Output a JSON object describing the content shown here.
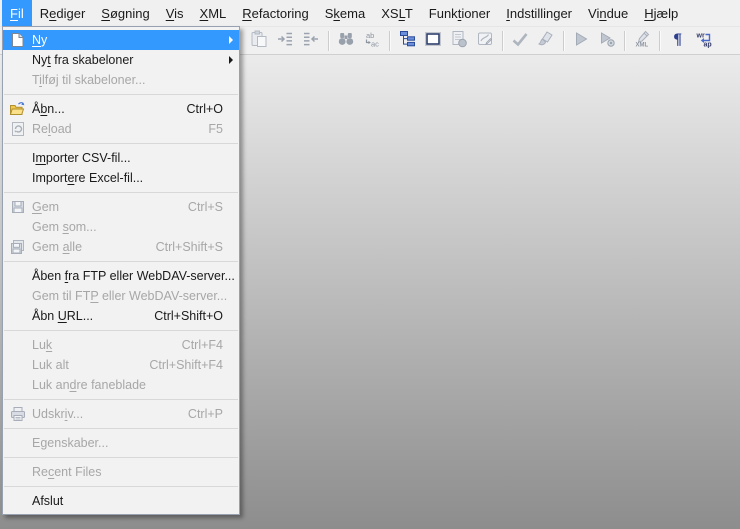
{
  "menubar": {
    "items": [
      {
        "id": "fil",
        "label": "Fil",
        "mnemonic": 0,
        "active": true
      },
      {
        "id": "rediger",
        "label": "Rediger",
        "mnemonic": 1
      },
      {
        "id": "sogning",
        "label": "Søgning",
        "mnemonic": 0
      },
      {
        "id": "vis",
        "label": "Vis",
        "mnemonic": 0
      },
      {
        "id": "xml",
        "label": "XML",
        "mnemonic": 0
      },
      {
        "id": "refactoring",
        "label": "Refactoring",
        "mnemonic": 0
      },
      {
        "id": "skema",
        "label": "Skema",
        "mnemonic": 1
      },
      {
        "id": "xslt",
        "label": "XSLT",
        "mnemonic": 2
      },
      {
        "id": "funktioner",
        "label": "Funktioner",
        "mnemonic": 4
      },
      {
        "id": "indstillinger",
        "label": "Indstillinger",
        "mnemonic": 0
      },
      {
        "id": "vindue",
        "label": "Vindue",
        "mnemonic": 2
      },
      {
        "id": "hjaelp",
        "label": "Hjælp",
        "mnemonic": 0
      }
    ]
  },
  "toolbar": {
    "groups": [
      {
        "icons": [
          {
            "name": "paste-icon",
            "enabled": false
          },
          {
            "name": "indent-right-icon",
            "enabled": false
          },
          {
            "name": "indent-left-icon",
            "enabled": false
          }
        ]
      },
      {
        "icons": [
          {
            "name": "binoculars-icon",
            "enabled": false
          },
          {
            "name": "replace-icon",
            "enabled": false
          }
        ]
      },
      {
        "icons": [
          {
            "name": "element-tree-icon",
            "enabled": true
          },
          {
            "name": "empty-box-icon",
            "enabled": true
          },
          {
            "name": "document-ball-icon",
            "enabled": false
          },
          {
            "name": "document-pen-icon",
            "enabled": false
          }
        ]
      },
      {
        "icons": [
          {
            "name": "checkmark-icon",
            "enabled": false
          },
          {
            "name": "brush-icon",
            "enabled": false
          }
        ]
      },
      {
        "icons": [
          {
            "name": "play-icon",
            "enabled": false
          },
          {
            "name": "play-gear-icon",
            "enabled": false
          }
        ]
      },
      {
        "icons": [
          {
            "name": "xml-dropper-icon",
            "enabled": false
          }
        ]
      },
      {
        "icons": [
          {
            "name": "pilcrow-icon",
            "enabled": true
          },
          {
            "name": "word-wrap-icon",
            "enabled": true
          }
        ]
      }
    ]
  },
  "file_menu": {
    "items": [
      {
        "id": "ny",
        "label": "Ny",
        "mnemonic": 0,
        "icon": "new-document-icon",
        "submenu": true,
        "highlighted": true,
        "enabled": true
      },
      {
        "id": "nyt-fra-skabeloner",
        "label": "Nyt fra skabeloner",
        "mnemonic": 2,
        "submenu": true,
        "enabled": true
      },
      {
        "id": "tilfoj-til-skabeloner",
        "label": "Tilføj til skabeloner...",
        "mnemonic": 1,
        "enabled": false
      },
      {
        "separator": true
      },
      {
        "id": "abn",
        "label": "Åbn...",
        "mnemonic": 1,
        "icon": "open-folder-icon",
        "shortcut": "Ctrl+O",
        "enabled": true
      },
      {
        "id": "reload",
        "label": "Reload",
        "mnemonic": 2,
        "icon": "reload-icon",
        "shortcut": "F5",
        "enabled": false
      },
      {
        "separator": true
      },
      {
        "id": "importer-csv-fil",
        "label": "Importer CSV-fil...",
        "mnemonic": 1,
        "enabled": true
      },
      {
        "id": "importere-excel-fil",
        "label": "Importere Excel-fil...",
        "mnemonic": 6,
        "enabled": true
      },
      {
        "separator": true
      },
      {
        "id": "gem",
        "label": "Gem",
        "mnemonic": 0,
        "icon": "save-icon",
        "shortcut": "Ctrl+S",
        "enabled": false
      },
      {
        "id": "gem-som",
        "label": "Gem som...",
        "mnemonic": 4,
        "enabled": false
      },
      {
        "id": "gem-alle",
        "label": "Gem alle",
        "mnemonic": 4,
        "icon": "save-all-icon",
        "shortcut": "Ctrl+Shift+S",
        "enabled": false
      },
      {
        "separator": true
      },
      {
        "id": "aben-fra-ftp",
        "label": "Åben fra FTP eller WebDAV-server...",
        "mnemonic": 5,
        "enabled": true
      },
      {
        "id": "gem-til-ftp",
        "label": "Gem til FTP eller WebDAV-server...",
        "mnemonic": 10,
        "enabled": false
      },
      {
        "id": "abn-url",
        "label": "Åbn URL...",
        "mnemonic": 4,
        "shortcut": "Ctrl+Shift+O",
        "enabled": true
      },
      {
        "separator": true
      },
      {
        "id": "luk",
        "label": "Luk",
        "mnemonic": 2,
        "shortcut": "Ctrl+F4",
        "enabled": false
      },
      {
        "id": "luk-alt",
        "label": "Luk alt",
        "shortcut": "Ctrl+Shift+F4",
        "enabled": false
      },
      {
        "id": "luk-andre-faneblade",
        "label": "Luk andre faneblade",
        "mnemonic": 6,
        "enabled": false
      },
      {
        "separator": true
      },
      {
        "id": "udskriv",
        "label": "Udskriv...",
        "mnemonic": 5,
        "icon": "print-icon",
        "shortcut": "Ctrl+P",
        "enabled": false
      },
      {
        "separator": true
      },
      {
        "id": "egenskaber",
        "label": "Egenskaber...",
        "enabled": false
      },
      {
        "separator": true
      },
      {
        "id": "recent-files",
        "label": "Recent Files",
        "mnemonic": 2,
        "enabled": false
      },
      {
        "separator": true
      },
      {
        "id": "afslut",
        "label": "Afslut",
        "enabled": true
      }
    ]
  },
  "colors": {
    "highlight": "#3399ff",
    "bar_bg": "#f0f0f0",
    "menu_bg": "#f2f2f2",
    "text": "#1a1a1a",
    "disabled_text": "#a7a7a7",
    "client_top": "#ebebeb",
    "client_bottom": "#8d8d8d"
  }
}
